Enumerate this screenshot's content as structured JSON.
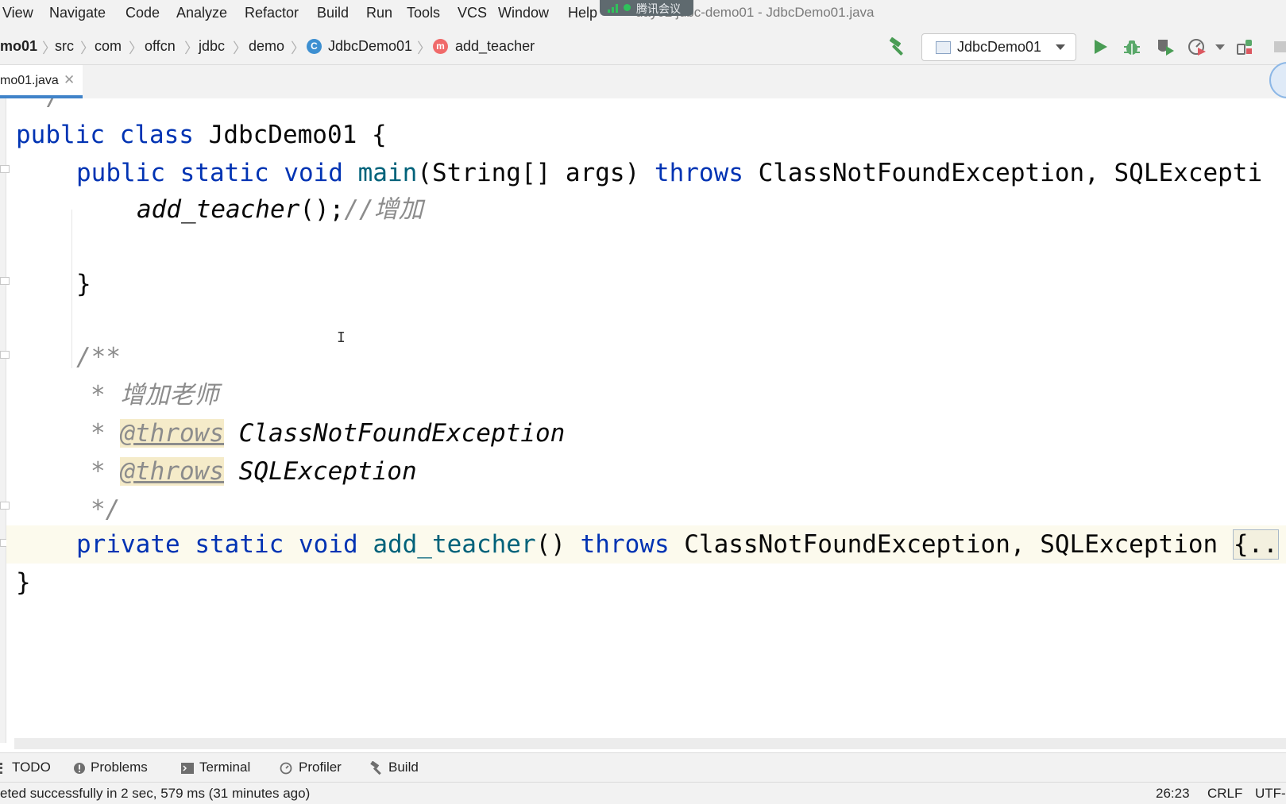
{
  "window": {
    "title": "day02 jdbc-demo01 - JdbcDemo01.java",
    "meeting_badge": "腾讯会议"
  },
  "menu": [
    "View",
    "Navigate",
    "Code",
    "Analyze",
    "Refactor",
    "Build",
    "Run",
    "Tools",
    "VCS",
    "Window",
    "Help"
  ],
  "breadcrumb": {
    "items": [
      "mo01",
      "src",
      "com",
      "offcn",
      "jdbc",
      "demo",
      "JdbcDemo01",
      "add_teacher"
    ],
    "class_icon_letter": "C",
    "method_icon_letter": "m"
  },
  "run_config": {
    "label": "JdbcDemo01"
  },
  "toolbar_icons": [
    "build-hammer-icon",
    "run-icon",
    "debug-icon",
    "coverage-icon",
    "profile-icon",
    "more-icon",
    "stop-icon"
  ],
  "editor_tab": {
    "label": "mo01.java"
  },
  "code": {
    "line_partial_top": "*/",
    "class_decl": {
      "kw1": "public",
      "kw2": "class",
      "name": "JdbcDemo01",
      "rest": " {"
    },
    "main_decl": {
      "kw1": "public",
      "kw2": "static",
      "kw3": "void",
      "name": "main",
      "params": "(String[] args) ",
      "kw4": "throws",
      "exceptions": " ClassNotFoundException, SQLExcepti"
    },
    "call": {
      "name": "add_teacher",
      "rest": "();",
      "comment": "//增加"
    },
    "close_brace": "}",
    "doc_open": "/**",
    "doc_desc": "* 增加老师",
    "doc_star": "*",
    "throws_tag": "@throws",
    "doc_throws1": "ClassNotFoundException",
    "doc_throws2": "SQLException",
    "doc_close": "*/",
    "method_decl": {
      "kw1": "private",
      "kw2": "static",
      "kw3": "void",
      "name": "add_teacher",
      "params": "() ",
      "kw4": "throws",
      "exceptions": " ClassNotFoundException, SQLException ",
      "folded": "{.."
    },
    "final_brace": "}"
  },
  "tool_windows": [
    "TODO",
    "Problems",
    "Terminal",
    "Profiler",
    "Build"
  ],
  "status": {
    "message": "eted successfully in 2 sec, 579 ms (31 minutes ago)",
    "position": "26:23",
    "line_sep": "CRLF",
    "encoding": "UTF-"
  },
  "colors": {
    "keyword": "#0033b3",
    "function": "#00627a",
    "comment": "#8c8c8c",
    "tab_accent": "#4083c9"
  }
}
